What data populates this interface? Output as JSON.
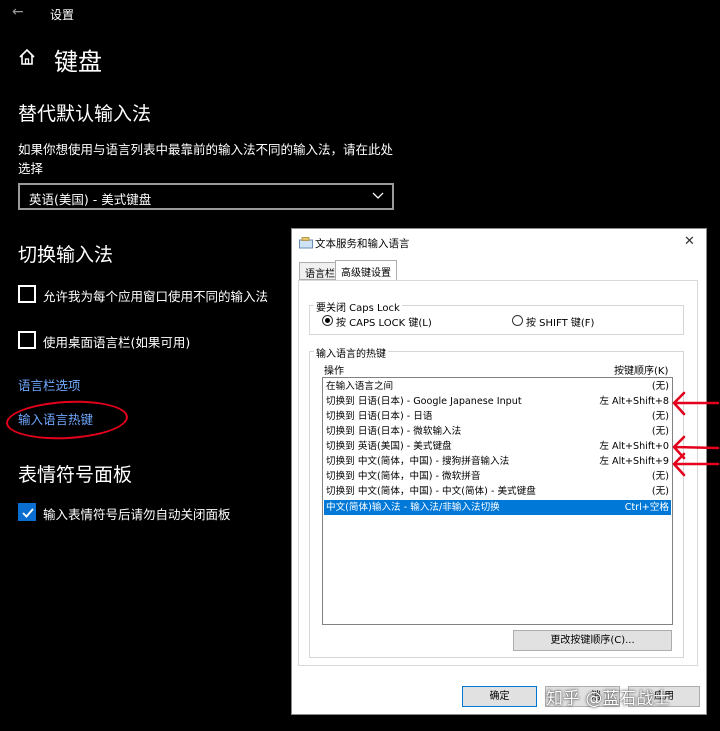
{
  "window": {
    "title": "设置"
  },
  "page": {
    "title": "键盘"
  },
  "override": {
    "title": "替代默认输入法",
    "description": "如果你想使用与语言列表中最靠前的输入法不同的输入法，请在此处选择",
    "selected": "英语(美国) - 美式键盘"
  },
  "switching": {
    "title": "切换输入法",
    "options": [
      {
        "label": "允许我为每个应用窗口使用不同的输入法",
        "checked": false
      },
      {
        "label": "使用桌面语言栏(如果可用)",
        "checked": false
      }
    ],
    "links": [
      "语言栏选项",
      "输入语言热键"
    ]
  },
  "emoji": {
    "title": "表情符号面板",
    "option": {
      "label": "输入表情符号后请勿自动关闭面板",
      "checked": true
    }
  },
  "dialog": {
    "title": "文本服务和输入语言",
    "tabs": [
      "语言栏",
      "高级键设置"
    ],
    "caps_group": {
      "label": "要关闭 Caps Lock",
      "options": [
        {
          "label": "按 CAPS LOCK 键(L)",
          "selected": true
        },
        {
          "label": "按 SHIFT 键(F)",
          "selected": false
        }
      ]
    },
    "hotkey_group": {
      "label": "输入语言的热键",
      "col_action": "操作",
      "col_key": "按键顺序(K)",
      "rows": [
        {
          "action": "在输入语言之间",
          "key": "(无)"
        },
        {
          "action": "切换到 日语(日本) - Google Japanese Input",
          "key": "左 Alt+Shift+8"
        },
        {
          "action": "切换到 日语(日本) - 日语",
          "key": "(无)"
        },
        {
          "action": "切换到 日语(日本) - 微软输入法",
          "key": "(无)"
        },
        {
          "action": "切换到 英语(美国) - 美式键盘",
          "key": "左 Alt+Shift+0"
        },
        {
          "action": "切换到 中文(简体，中国) - 搜狗拼音输入法",
          "key": "左 Alt+Shift+9"
        },
        {
          "action": "切换到 中文(简体，中国) - 微软拼音",
          "key": "(无)"
        },
        {
          "action": "切换到 中文(简体，中国) - 中文(简体) - 美式键盘",
          "key": "(无)"
        },
        {
          "action": "中文(简体)输入法 - 输入法/非输入法切换",
          "key": "Ctrl+空格",
          "selected": true
        }
      ],
      "change_button": "更改按键顺序(C)..."
    },
    "ok_button": "确定",
    "cancel_fragment": "消",
    "apply_fragment": "应用"
  },
  "watermark": "知乎 @蓝石战士",
  "colors": {
    "accent": "#0a6ed1",
    "link": "#6fa8ff",
    "annotation": "#e4001c",
    "selection": "#0078d7"
  }
}
